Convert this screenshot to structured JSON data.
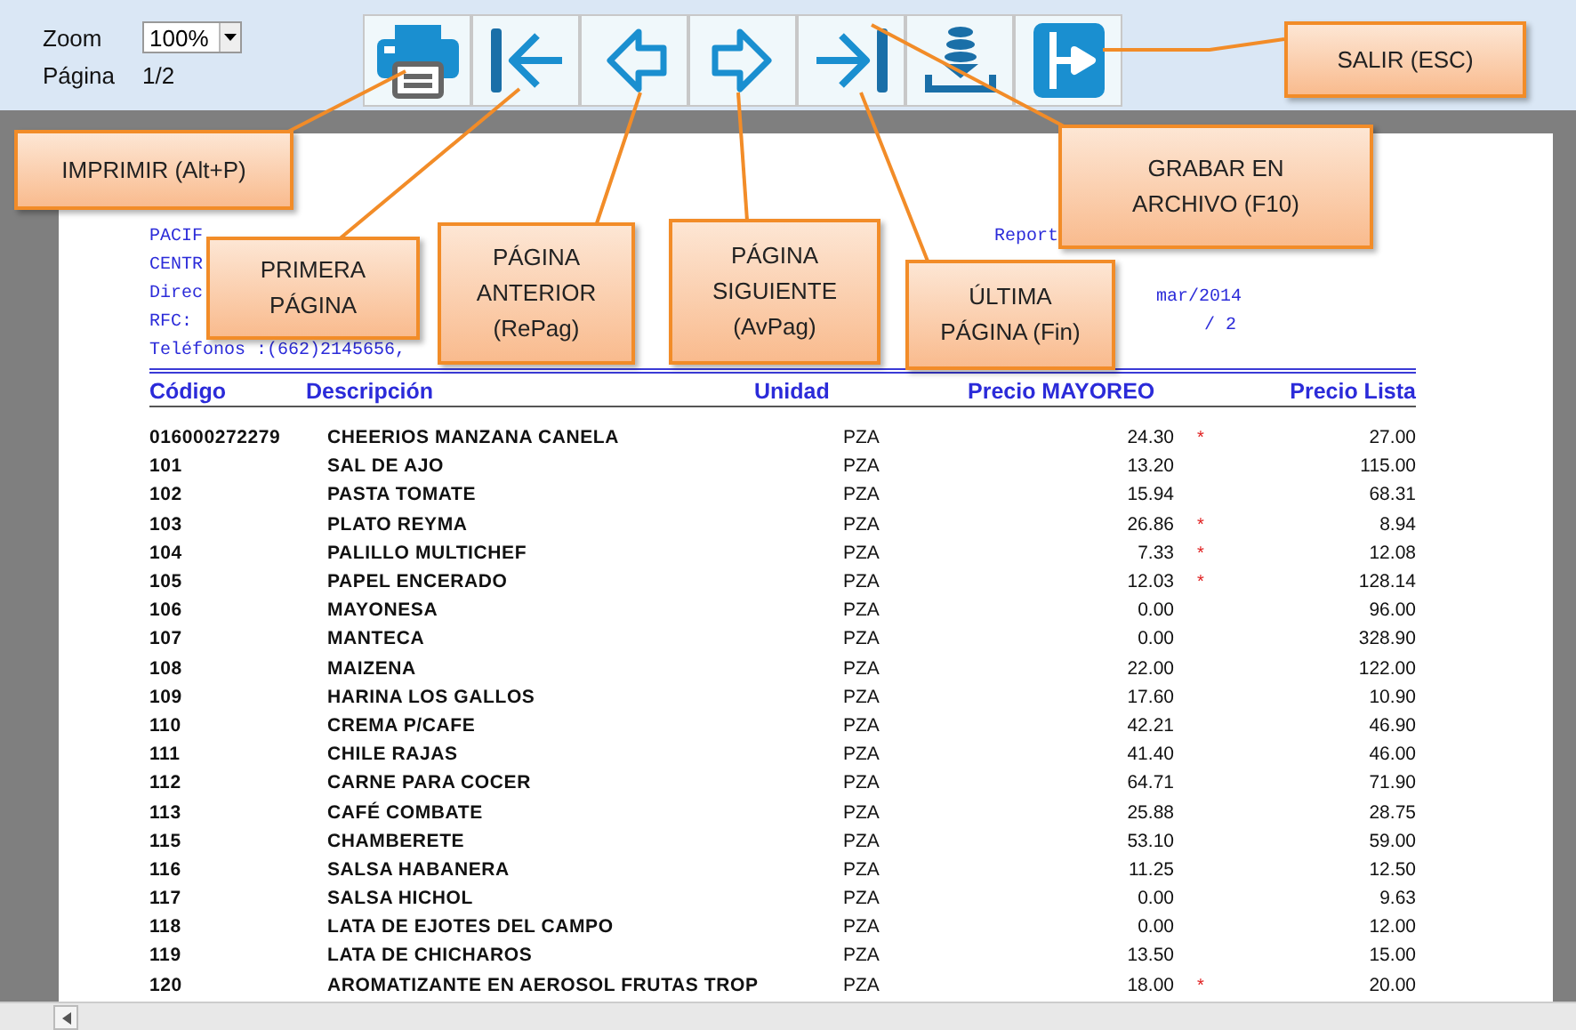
{
  "toolbar": {
    "zoom_label": "Zoom",
    "zoom_value": "100%",
    "page_label": "Página",
    "page_value": "1/2",
    "buttons": [
      {
        "kind": "print"
      },
      {
        "kind": "first"
      },
      {
        "kind": "prev"
      },
      {
        "kind": "next"
      },
      {
        "kind": "last"
      },
      {
        "kind": "save"
      },
      {
        "kind": "exit"
      }
    ]
  },
  "report": {
    "header_left": [
      "PACIF",
      "CENTR",
      "Direc",
      "RFC:",
      "Teléfonos :(662)2145656,"
    ],
    "header_right": [
      "Report",
      "mar/2014",
      "/ 2"
    ],
    "columns": [
      "Código",
      "Descripción",
      "Unidad",
      "Precio MAYOREO",
      "Precio Lista"
    ],
    "rows": [
      {
        "code": "016000272279",
        "description": "CHEERIOS MANZANA CANELA",
        "unit": "PZA",
        "wholesale": "24.30",
        "flag": "*",
        "list": "27.00"
      },
      {
        "code": "101",
        "description": "SAL DE AJO",
        "unit": "PZA",
        "wholesale": "13.20",
        "list": "115.00"
      },
      {
        "code": "102",
        "description": "PASTA TOMATE",
        "unit": "PZA",
        "wholesale": "15.94",
        "list": "68.31"
      },
      {
        "code": "103",
        "description": "PLATO REYMA",
        "unit": "PZA",
        "wholesale": "26.86",
        "flag": "*",
        "list": "8.94"
      },
      {
        "code": "104",
        "description": "PALILLO MULTICHEF",
        "unit": "PZA",
        "wholesale": "7.33",
        "flag": "*",
        "list": "12.08"
      },
      {
        "code": "105",
        "description": "PAPEL ENCERADO",
        "unit": "PZA",
        "wholesale": "12.03",
        "flag": "*",
        "list": "128.14"
      },
      {
        "code": "106",
        "description": "MAYONESA",
        "unit": "PZA",
        "wholesale": "0.00",
        "list": "96.00"
      },
      {
        "code": "107",
        "description": "MANTECA",
        "unit": "PZA",
        "wholesale": "0.00",
        "list": "328.90"
      },
      {
        "code": "108",
        "description": "MAIZENA",
        "unit": "PZA",
        "wholesale": "22.00",
        "list": "122.00"
      },
      {
        "code": "109",
        "description": "HARINA LOS GALLOS",
        "unit": "PZA",
        "wholesale": "17.60",
        "list": "10.90"
      },
      {
        "code": "110",
        "description": "CREMA P/CAFE",
        "unit": "PZA",
        "wholesale": "42.21",
        "list": "46.90"
      },
      {
        "code": "111",
        "description": "CHILE RAJAS",
        "unit": "PZA",
        "wholesale": "41.40",
        "list": "46.00"
      },
      {
        "code": "112",
        "description": "CARNE PARA COCER",
        "unit": "PZA",
        "wholesale": "64.71",
        "list": "71.90"
      },
      {
        "code": "113",
        "description": "CAFÉ COMBATE",
        "unit": "PZA",
        "wholesale": "25.88",
        "list": "28.75"
      },
      {
        "code": "115",
        "description": "CHAMBERETE",
        "unit": "PZA",
        "wholesale": "53.10",
        "list": "59.00"
      },
      {
        "code": "116",
        "description": "SALSA HABANERA",
        "unit": "PZA",
        "wholesale": "11.25",
        "list": "12.50"
      },
      {
        "code": "117",
        "description": "SALSA HICHOL",
        "unit": "PZA",
        "wholesale": "0.00",
        "list": "9.63"
      },
      {
        "code": "118",
        "description": "LATA DE EJOTES DEL CAMPO",
        "unit": "PZA",
        "wholesale": "0.00",
        "list": "12.00"
      },
      {
        "code": "119",
        "description": "LATA DE CHICHAROS",
        "unit": "PZA",
        "wholesale": "13.50",
        "list": "15.00"
      },
      {
        "code": "120",
        "description": "AROMATIZANTE EN AEROSOL FRUTAS TROP",
        "unit": "PZA",
        "wholesale": "18.00",
        "flag": "*",
        "list": "20.00"
      }
    ]
  },
  "callouts": [
    {
      "text": "IMPRIMIR (Alt+P)"
    },
    {
      "text": "PRIMERA PÁGINA"
    },
    {
      "text": "PÁGINA ANTERIOR (RePag)"
    },
    {
      "text": "PÁGINA SIGUIENTE (AvPag)"
    },
    {
      "text": "ÚLTIMA PÁGINA (Fin)"
    },
    {
      "text": "GRABAR EN ARCHIVO (F10)"
    },
    {
      "text": "SALIR (ESC)"
    }
  ]
}
